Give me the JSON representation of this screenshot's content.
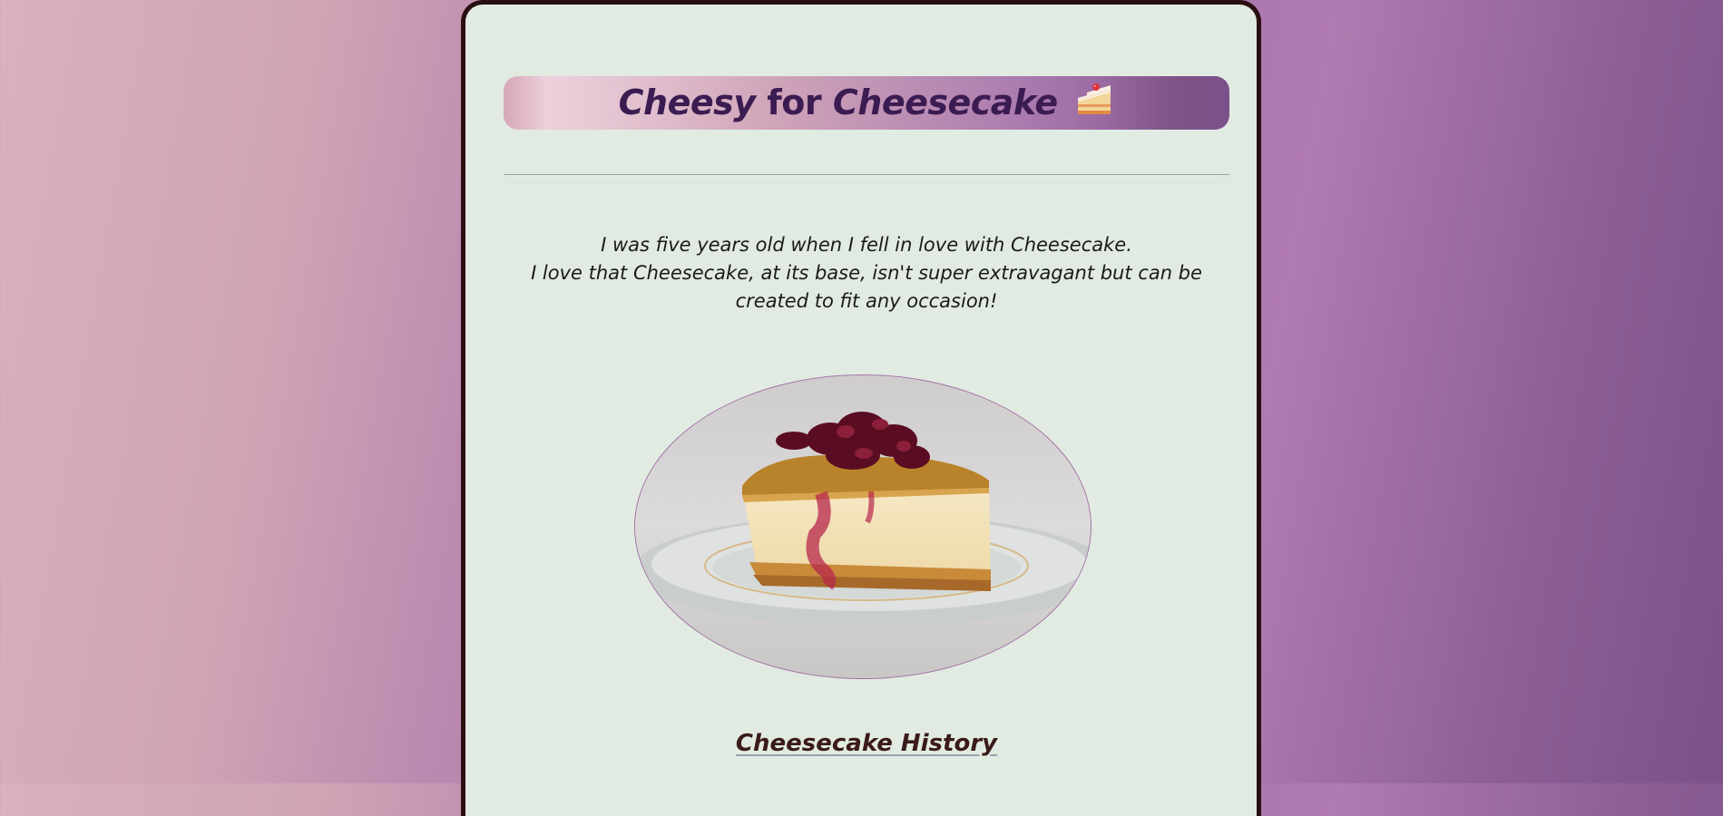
{
  "header": {
    "title_part1": "Cheesy",
    "title_part2": "for",
    "title_part3": "Cheesecake",
    "icon": "shortcake-slice-icon"
  },
  "intro": {
    "line1": "I was five years old when I fell in love with Cheesecake.",
    "line2": "I love that Cheesecake, at its base, isn't super extravagant but can be",
    "line3": "created to fit any occasion!"
  },
  "image": {
    "subject": "cheesecake-slice-photo"
  },
  "section": {
    "history_link": "Cheesecake History"
  },
  "colors": {
    "title": "#3b1c52",
    "card_bg": "#e1ebe2",
    "card_border": "#2a0f12",
    "link": "#3b1a1a",
    "accent": "#a26ea6"
  }
}
